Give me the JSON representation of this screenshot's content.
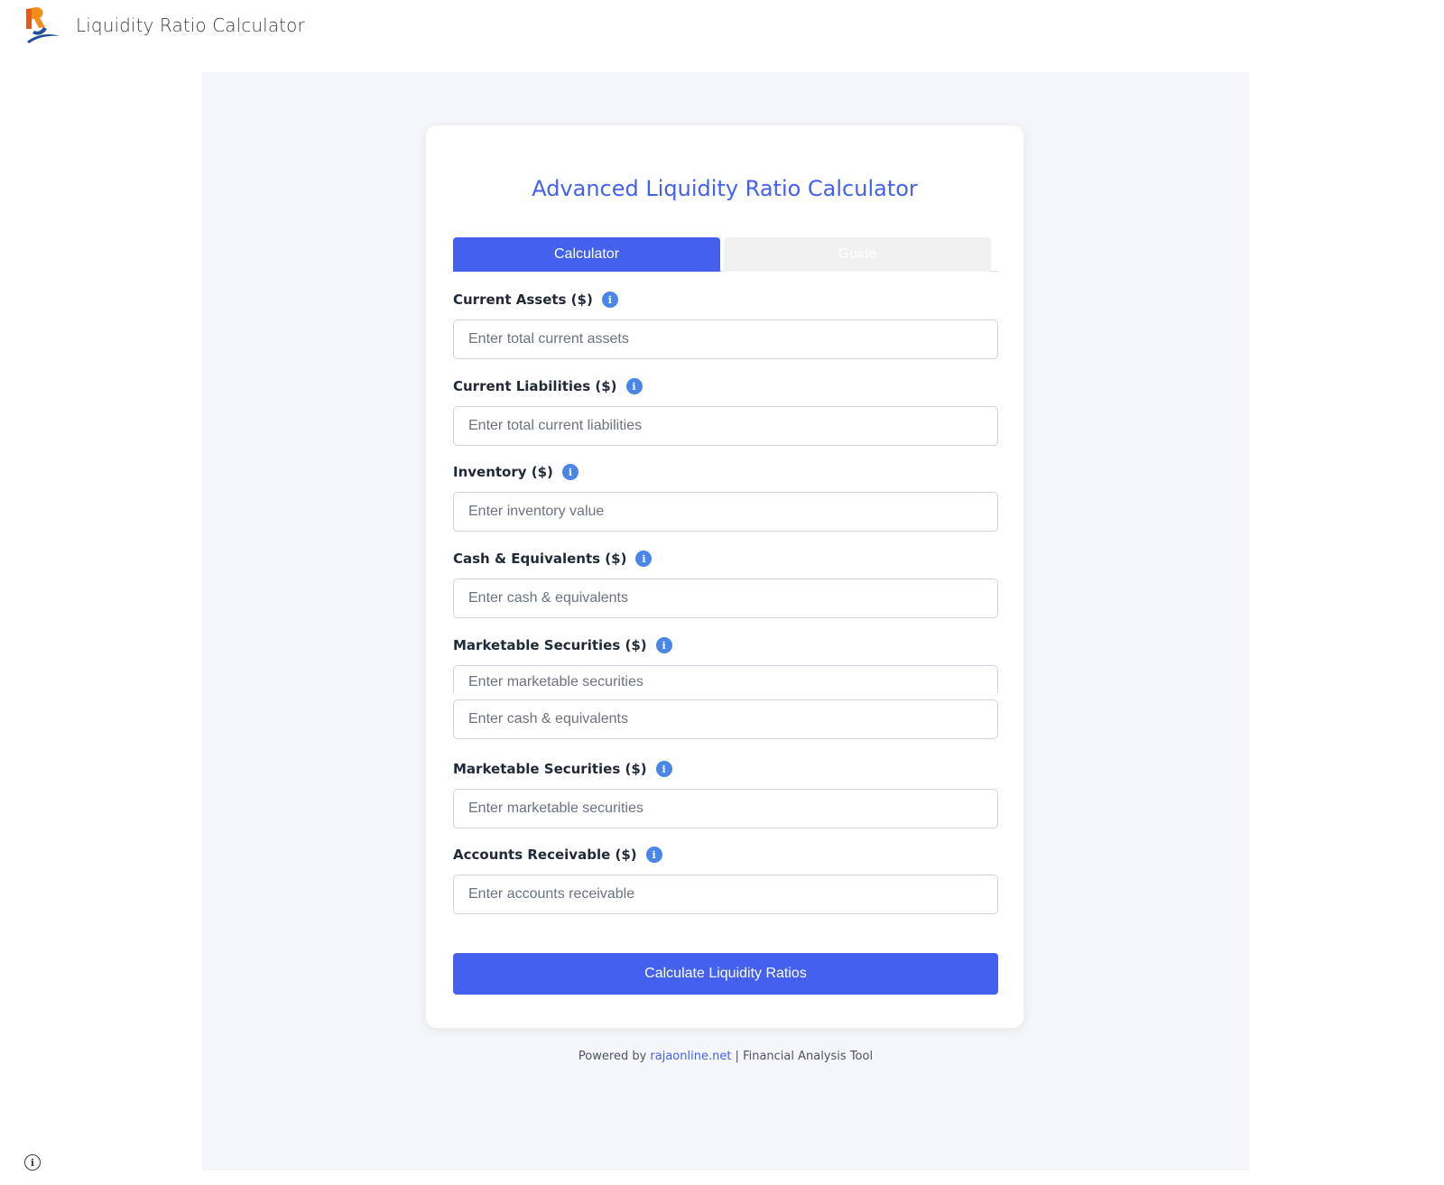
{
  "app": {
    "title": "Liquidity Ratio Calculator"
  },
  "card": {
    "title": "Advanced Liquidity Ratio Calculator"
  },
  "tabs": [
    {
      "label": "Calculator",
      "active": true
    },
    {
      "label": "Guide",
      "active": false
    }
  ],
  "fields": [
    {
      "label": "Current Assets ($)",
      "placeholder": "Enter total current assets",
      "value": ""
    },
    {
      "label": "Current Liabilities ($)",
      "placeholder": "Enter total current liabilities",
      "value": ""
    },
    {
      "label": "Inventory ($)",
      "placeholder": "Enter inventory value",
      "value": ""
    },
    {
      "label": "Cash & Equivalents ($)",
      "placeholder": "Enter cash & equivalents",
      "value": ""
    },
    {
      "label": "Marketable Securities ($)",
      "placeholder": "Enter marketable securities",
      "value": ""
    },
    {
      "label": "",
      "placeholder": "Enter cash & equivalents",
      "value": ""
    },
    {
      "label": "Marketable Securities ($)",
      "placeholder": "Enter marketable securities",
      "value": ""
    },
    {
      "label": "Accounts Receivable ($)",
      "placeholder": "Enter accounts receivable",
      "value": ""
    }
  ],
  "info_icon_glyph": "i",
  "calculate_button": {
    "label": "Calculate Liquidity Ratios"
  },
  "footer": {
    "prefix": "Powered by ",
    "link_text": "rajaonline.net",
    "suffix": " | Financial Analysis Tool"
  },
  "colors": {
    "accent": "#4361ee",
    "info": "#4a86e8",
    "background": "#f5f6f9"
  }
}
